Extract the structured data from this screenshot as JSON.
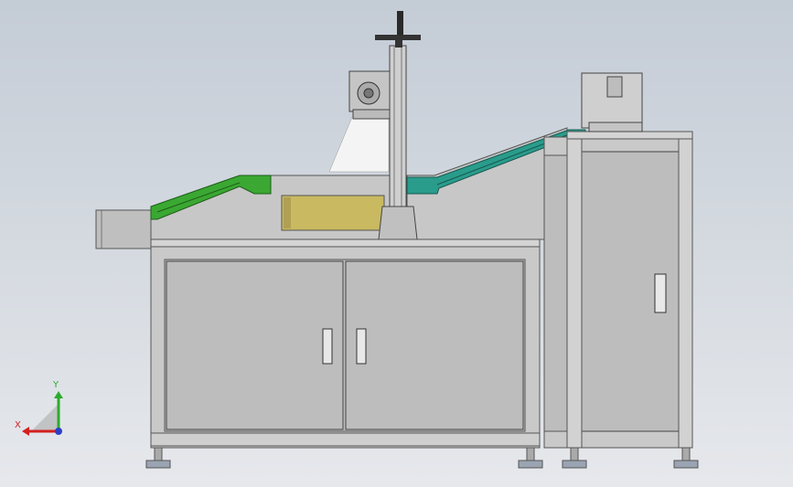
{
  "viewport": {
    "background_top": "#c4ccd6",
    "background_bottom": "#e6e8ec"
  },
  "model": {
    "frame_color": "#c9c9c9",
    "panel_color": "#bdbdbd",
    "conveyor_left_color": "#3aa832",
    "conveyor_right_color": "#2a9c8c",
    "window_color": "#c9b960",
    "foot_color": "#9aa4b2"
  },
  "triad": {
    "y_label": "Y",
    "x_label": "X",
    "y_color": "#2cab2c",
    "x_color": "#d42020"
  }
}
